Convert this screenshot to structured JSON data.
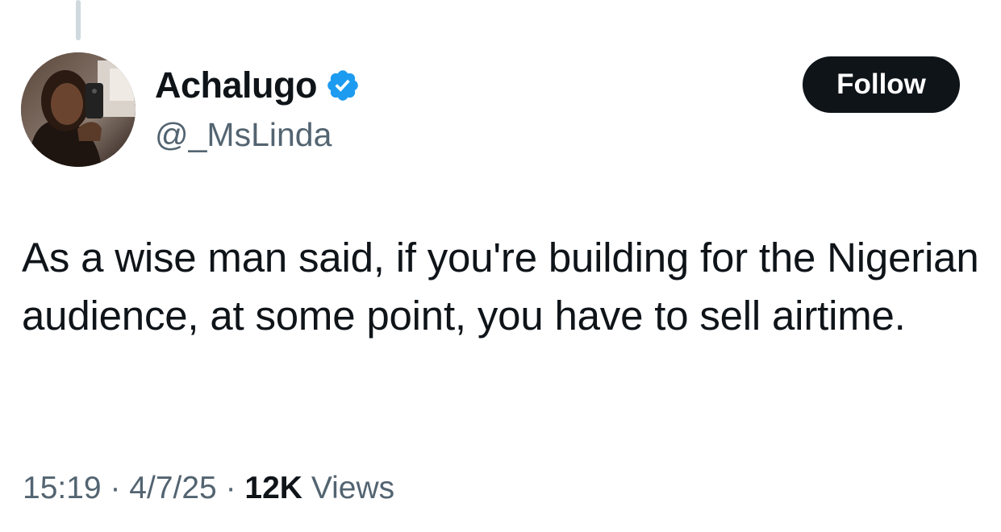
{
  "tweet": {
    "author": {
      "display_name": "Achalugo",
      "handle": "@_MsLinda",
      "verified": true,
      "avatar_icon": "profile-photo",
      "verified_icon": "verified-badge-icon",
      "verified_color": "#1d9bf0"
    },
    "follow_label": "Follow",
    "text": "As a wise man said, if you're building for the Nigerian audience, at some point, you have to sell airtime.",
    "time": "15:19",
    "date": "4/7/25",
    "separator": "·",
    "views_count": "12K",
    "views_label": "Views"
  },
  "colors": {
    "text_primary": "#0f1419",
    "text_secondary": "#536471",
    "follow_bg": "#0f1419",
    "follow_text": "#ffffff",
    "thread_line": "#cfd9de"
  }
}
